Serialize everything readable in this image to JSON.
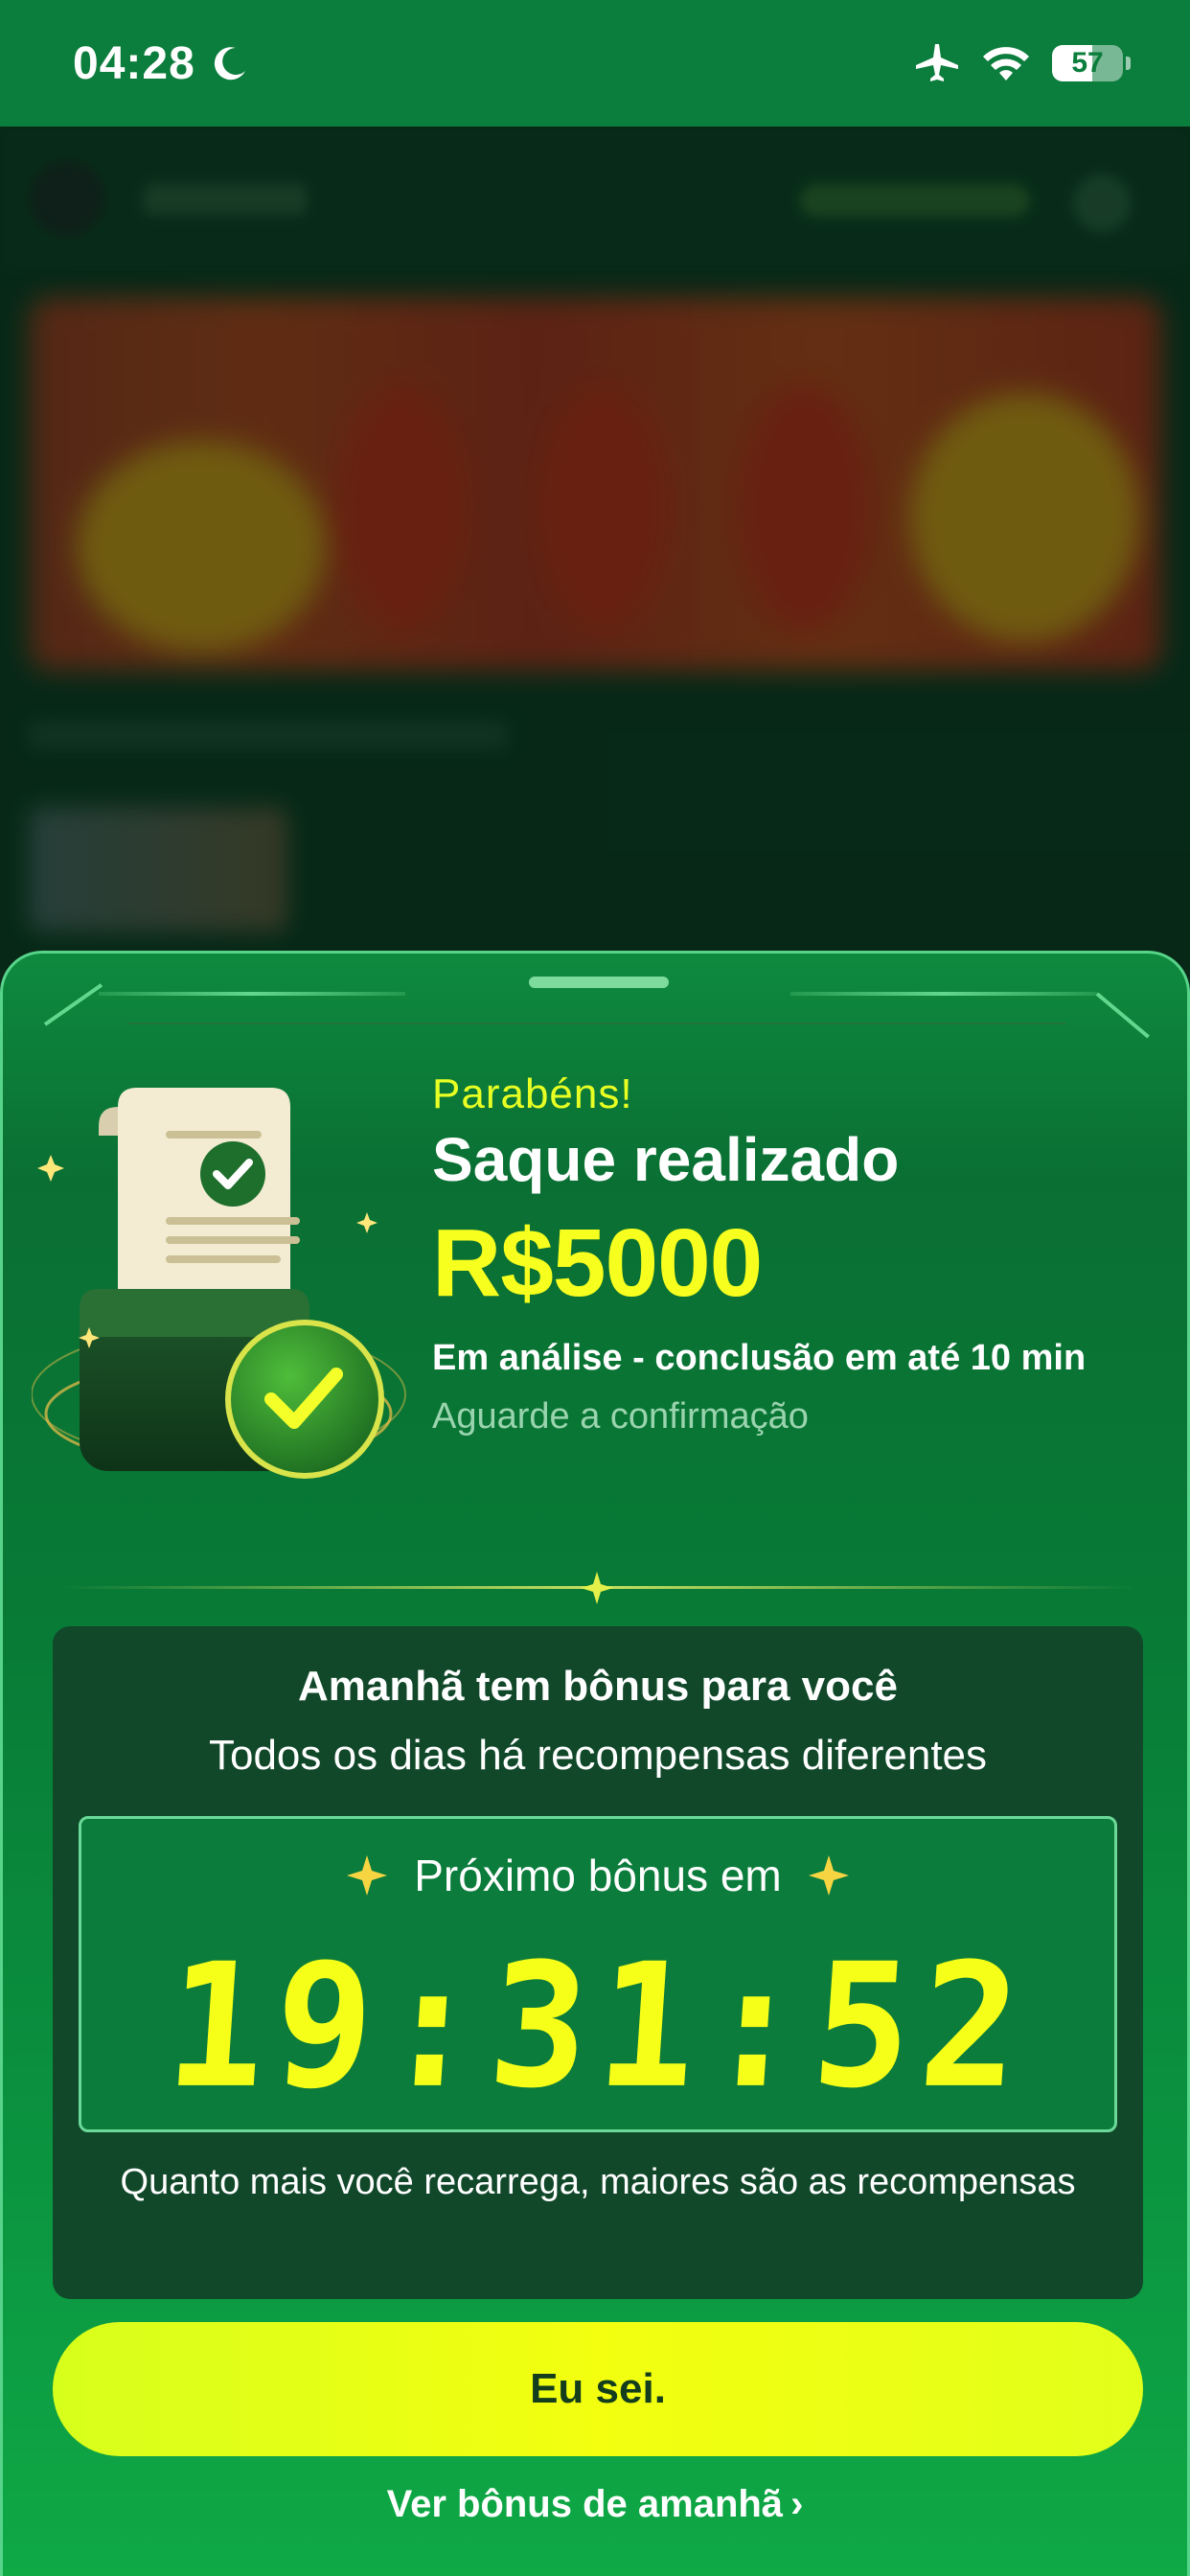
{
  "status_bar": {
    "time": "04:28",
    "battery_level": "57",
    "icons": [
      "moon-icon",
      "airplane-icon",
      "wifi-icon",
      "battery-icon"
    ]
  },
  "sheet": {
    "congrats": "Parabéns!",
    "title": "Saque realizado",
    "amount": "R$5000",
    "status_line": "Em análise - conclusão em até 10 min",
    "wait_line": "Aguarde a confirmação",
    "bonus": {
      "title": "Amanhã tem bônus para você",
      "subtitle": "Todos os dias há recompensas diferentes",
      "timer_label": "Próximo bônus em",
      "timer_value": "19:31:52",
      "note": "Quanto mais você recarrega, maiores são as recompensas"
    },
    "primary_button": "Eu sei.",
    "link": "Ver bônus de amanhã"
  },
  "colors": {
    "accent_yellow": "#f6ff18",
    "sheet_green": "#0a6f33",
    "card_green": "#11482a",
    "status_green": "#0b7d3c"
  }
}
